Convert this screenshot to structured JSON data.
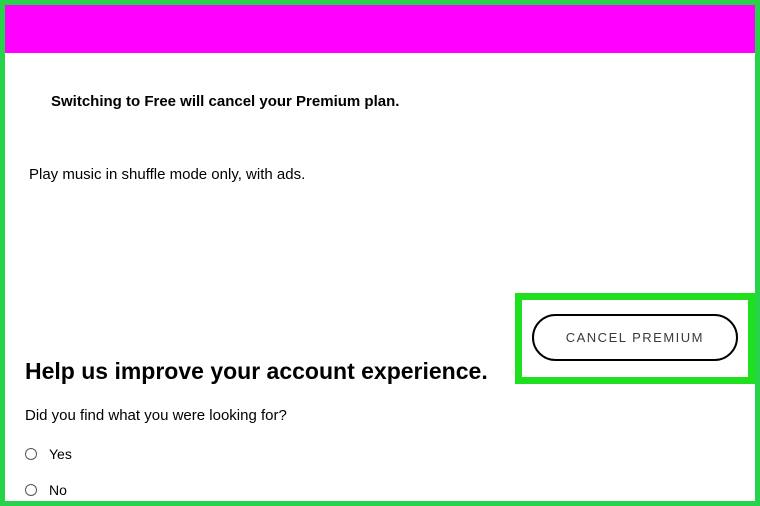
{
  "notice": "Switching to Free will cancel your Premium plan.",
  "subtext": "Play music in shuffle mode only, with ads.",
  "actions": {
    "cancel_premium": "CANCEL PREMIUM"
  },
  "survey": {
    "heading": "Help us improve your account experience.",
    "question": "Did you find what you were looking for?",
    "options": {
      "yes": "Yes",
      "no": "No"
    }
  }
}
